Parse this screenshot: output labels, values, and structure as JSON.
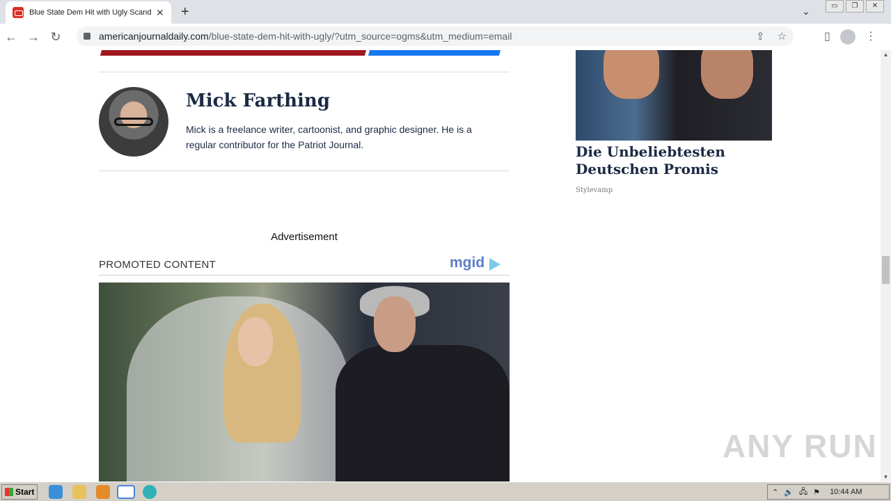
{
  "browser": {
    "tab_title": "Blue State Dem Hit with Ugly Scanda",
    "tab_close": "✕",
    "new_tab": "+",
    "tab_menu": "⌄",
    "window_controls": [
      "▭",
      "❐",
      "✕"
    ],
    "url_host": "americanjournaldaily.com",
    "url_path": "/blue-state-dem-hit-with-ugly/?utm_source=ogms&utm_medium=email",
    "nav": {
      "back": "←",
      "forward": "→",
      "reload": "↻"
    },
    "omni_icons": {
      "share": "⇪",
      "bookmark": "☆"
    },
    "toolbar_icons": {
      "side_panel": "▯",
      "menu": "⋮"
    }
  },
  "author": {
    "name": "Mick Farthing",
    "bio": "Mick is a freelance writer, cartoonist, and graphic designer. He is a regular contributor for the Patriot Journal."
  },
  "ad": {
    "label": "Advertisement",
    "promoted": "PROMOTED CONTENT",
    "network": "mgid"
  },
  "sidebar": {
    "title": "Die Unbeliebtesten Deutschen Promis",
    "source": "Stylevamp"
  },
  "scroll": {
    "up": "▲",
    "down": "▼"
  },
  "watermark": "ANY RUN",
  "taskbar": {
    "start": "Start",
    "tray_icons": [
      "⌃",
      "🔊",
      "🖧",
      "⚑"
    ],
    "clock": "10:44 AM",
    "accent": "#d4d0c8"
  }
}
